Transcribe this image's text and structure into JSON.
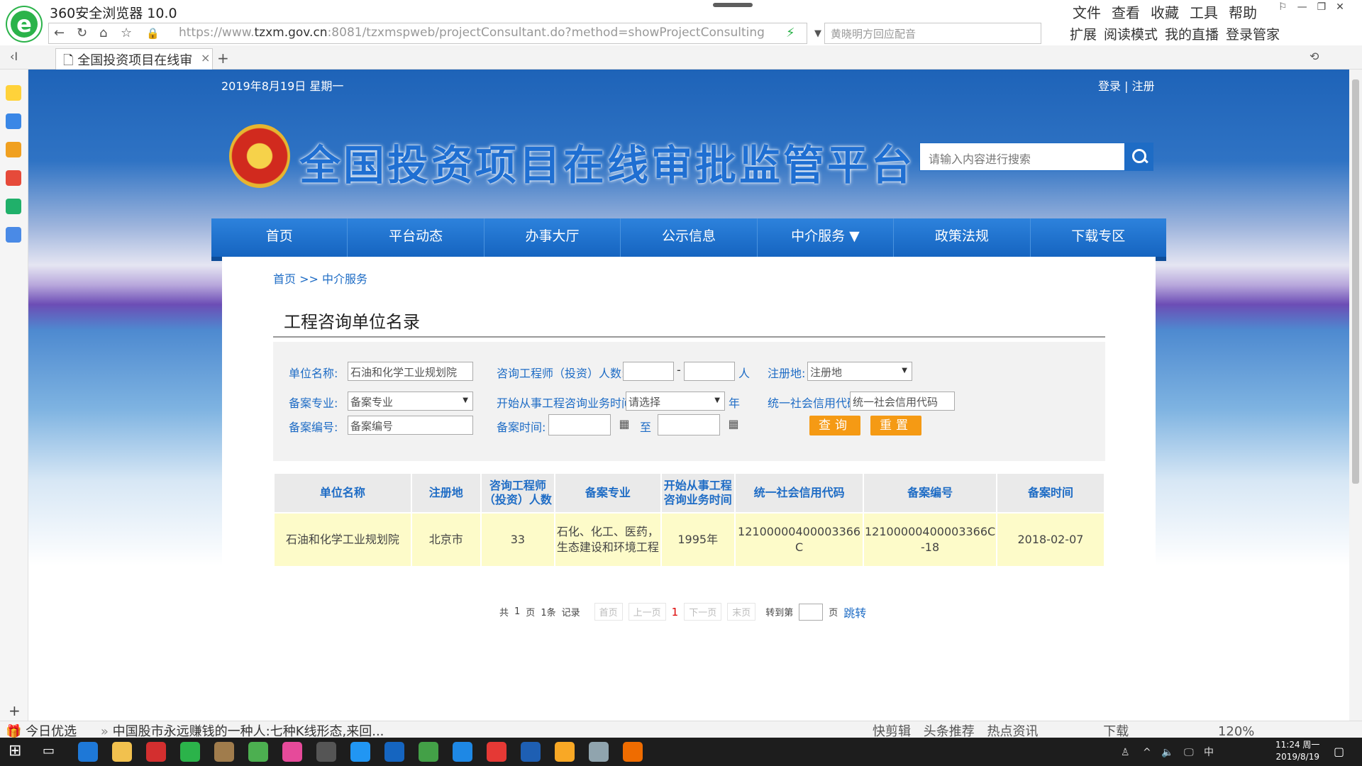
{
  "browser": {
    "app_title": "360安全浏览器 10.0",
    "menus": [
      "文件",
      "查看",
      "收藏",
      "工具",
      "帮助"
    ],
    "url_prefix": "https://www.",
    "url_domain": "tzxm.gov.cn",
    "url_rest": ":8081/tzxmspweb/projectConsultant.do?method=showProjectConsulting",
    "search_placeholder": "黄晓明方回应配音",
    "toolbar": [
      "扩展",
      "阅读模式",
      "我的直播",
      "登录管家"
    ],
    "tab_title": "全国投资项目在线审",
    "tab_close": "×",
    "new_tab": "+",
    "status_left": "今日优选",
    "status_news": "中国股市永远赚钱的一种人:七种K线形态,来回...",
    "status_right": [
      "快剪辑",
      "头条推荐",
      "热点资讯",
      "下载",
      "120%"
    ]
  },
  "header": {
    "date": "2019年8月19日 星期一",
    "login": "登录",
    "separator": "|",
    "register": "注册",
    "site_title": "全国投资项目在线审批监管平台",
    "search_placeholder": "请输入内容进行搜索"
  },
  "nav": {
    "items": [
      {
        "label": "首页"
      },
      {
        "label": "平台动态"
      },
      {
        "label": "办事大厅"
      },
      {
        "label": "公示信息"
      },
      {
        "label": "中介服务 ▼"
      },
      {
        "label": "政策法规"
      },
      {
        "label": "下载专区"
      }
    ]
  },
  "breadcrumb": "首页 >> 中介服务",
  "page_title": "工程咨询单位名录",
  "filter": {
    "unit_name_label": "单位名称:",
    "unit_name_value": "石油和化学工业规划院",
    "engineers_label": "咨询工程师（投资）人数:",
    "range_sep": "-",
    "persons_unit": "人",
    "region_label": "注册地:",
    "region_value": "注册地",
    "specialty_label": "备案专业:",
    "specialty_value": "备案专业",
    "start_time_label": "开始从事工程咨询业务时间:",
    "start_time_value": "请选择",
    "year_unit": "年",
    "credit_label": "统一社会信用代码:",
    "credit_placeholder": "统一社会信用代码",
    "record_no_label": "备案编号:",
    "record_no_placeholder": "备案编号",
    "record_time_label": "备案时间:",
    "to_label": "至",
    "query_button": "查询",
    "reset_button": "重置"
  },
  "table": {
    "columns": [
      "单位名称",
      "注册地",
      "咨询工程师（投资）人数",
      "备案专业",
      "开始从事工程咨询业务时间",
      "统一社会信用代码",
      "备案编号",
      "备案时间"
    ],
    "rows": [
      [
        "石油和化学工业规划院",
        "北京市",
        "33",
        "石化、化工、医药，生态建设和环境工程",
        "1995年",
        "12100000400003366C",
        "12100000400003366C-18",
        "2018-02-07"
      ]
    ]
  },
  "pager": {
    "total_prefix": "共",
    "pages": "1",
    "pages_unit": "页",
    "records": "1条",
    "records_unit": "记录",
    "first": "首页",
    "prev": "上一页",
    "current": "1",
    "next": "下一页",
    "last": "末页",
    "goto_label": "转到第",
    "goto_unit": "页",
    "jump": "跳转"
  },
  "taskbar": {
    "clock_time": "11:24 周一",
    "clock_date": "2019/8/19",
    "ime": "中"
  }
}
